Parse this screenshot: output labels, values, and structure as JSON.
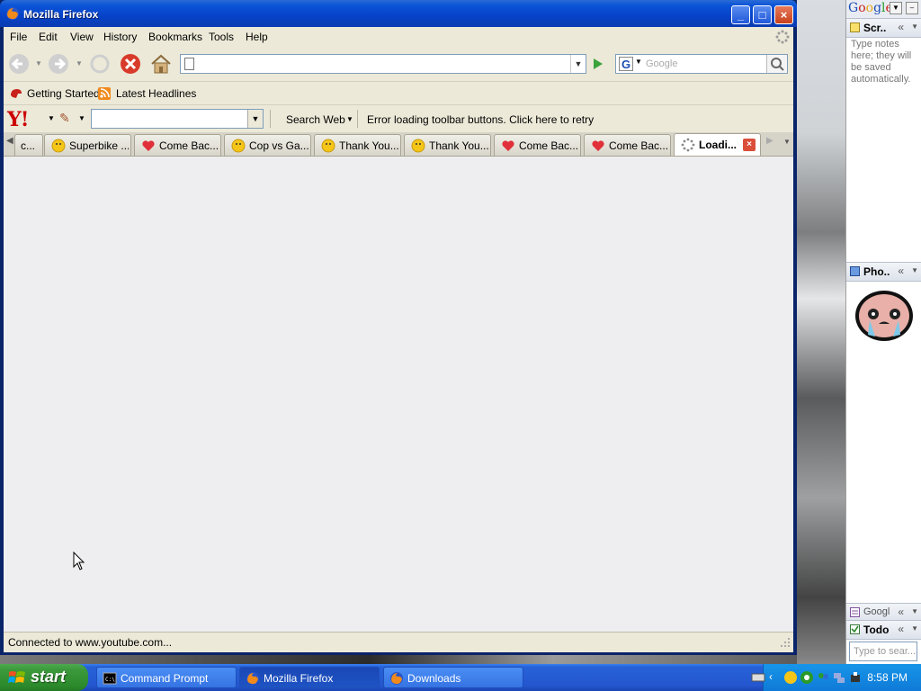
{
  "window": {
    "title": "Mozilla Firefox"
  },
  "menu": [
    "File",
    "Edit",
    "View",
    "History",
    "Bookmarks",
    "Tools",
    "Help"
  ],
  "url": {
    "value": ""
  },
  "search": {
    "placeholder": "Google"
  },
  "bookmarks": [
    {
      "label": "Getting Started",
      "icon": "getting-started-icon"
    },
    {
      "label": "Latest Headlines",
      "icon": "rss-icon"
    }
  ],
  "yahoo_toolbar": {
    "search_web": "Search Web",
    "error_message": "Error loading toolbar buttons. Click here to retry"
  },
  "tabs": [
    {
      "label": "c...",
      "icon": "none"
    },
    {
      "label": "Superbike ...",
      "icon": "smiley-icon"
    },
    {
      "label": "Come Bac...",
      "icon": "heart-icon"
    },
    {
      "label": "Cop vs Ga...",
      "icon": "smiley-icon"
    },
    {
      "label": "Thank You...",
      "icon": "smiley-icon"
    },
    {
      "label": "Thank You...",
      "icon": "smiley-icon"
    },
    {
      "label": "Come Bac...",
      "icon": "heart-icon"
    },
    {
      "label": "Come Bac...",
      "icon": "heart-icon"
    },
    {
      "label": "Loadi...",
      "icon": "loading-icon",
      "active": true
    }
  ],
  "status": {
    "text": "Connected to www.youtube.com..."
  },
  "sidebar": {
    "logo": "Google",
    "scratch_title": "Scr..",
    "notes_text": "Type notes here; they will be saved automatically.",
    "photos_title": "Pho..",
    "google_title": "Googl",
    "todo_title": "Todo",
    "todo_search_placeholder": "Type to sear..."
  },
  "taskbar": {
    "start": "start",
    "tasks": [
      {
        "label": "Command Prompt",
        "icon": "cmd-icon"
      },
      {
        "label": "Mozilla Firefox",
        "icon": "firefox-icon",
        "active": true
      },
      {
        "label": "Downloads",
        "icon": "firefox-icon"
      }
    ],
    "clock": "8:58 PM"
  },
  "colors": {
    "titlebar": "#0b54d8",
    "taskbar": "#2456cf",
    "start": "#3c9a3c",
    "tray": "#0f7ad8"
  }
}
